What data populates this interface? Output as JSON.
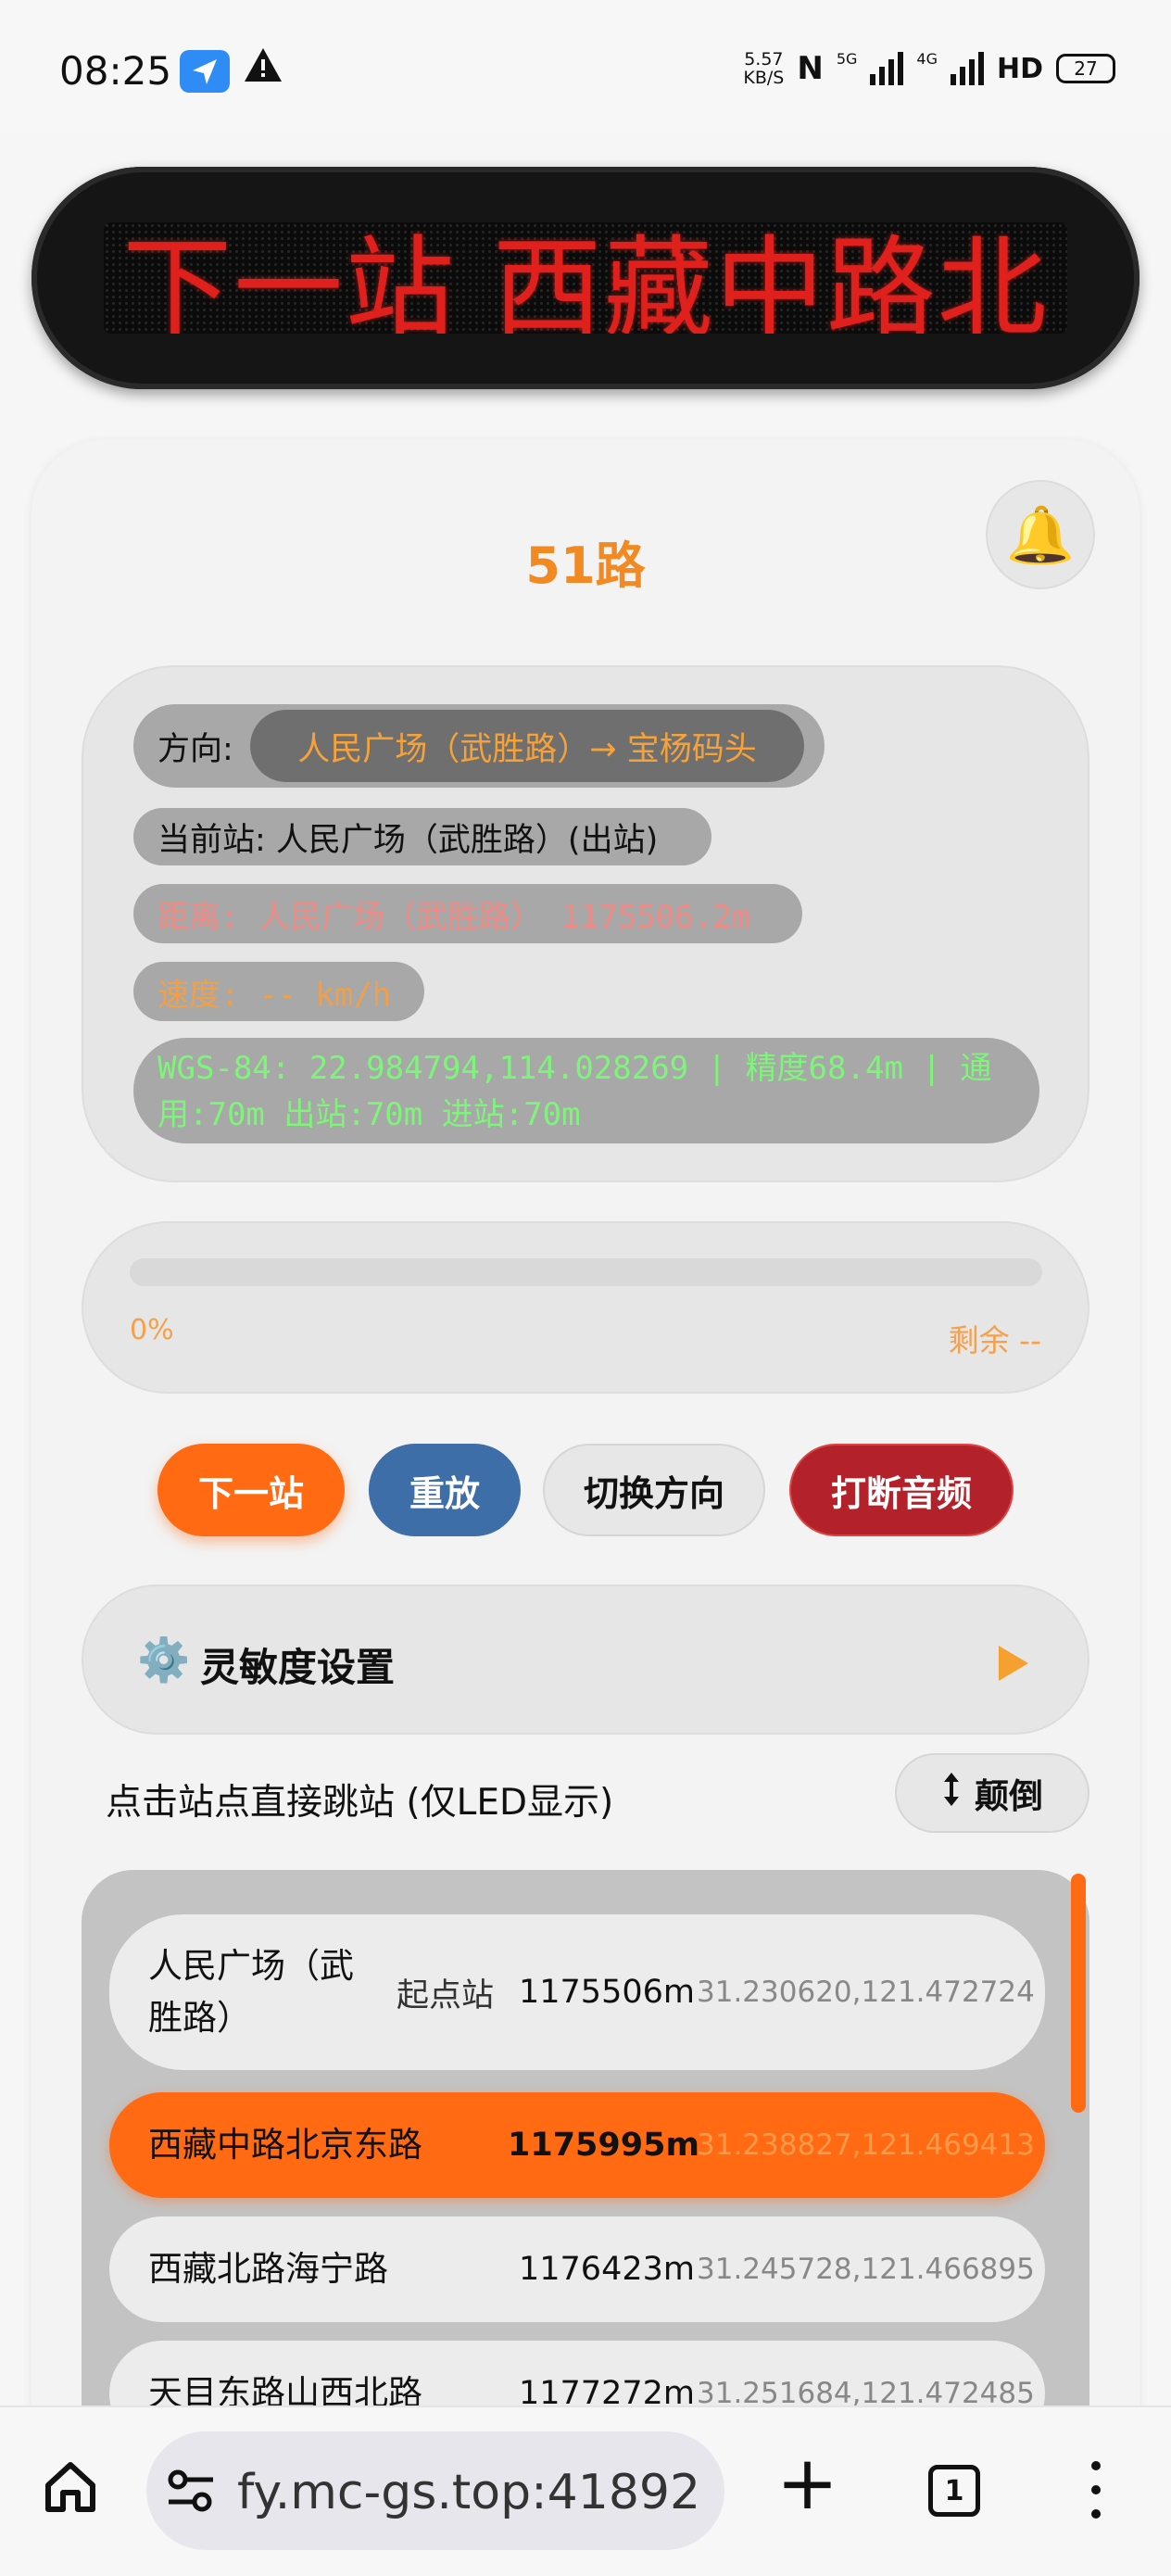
{
  "status_bar": {
    "time": "08:25",
    "net_speed_top": "5.57",
    "net_speed_unit": "KB/S",
    "signal_5g": "5G",
    "signal_4g": "4G",
    "hd": "HD",
    "battery": "27",
    "icons": [
      "navigation-icon",
      "warning-icon",
      "nfc-icon",
      "signal-icon"
    ]
  },
  "led": {
    "text": "下一站  西藏中路北",
    "color": "#e0201c"
  },
  "route": {
    "title": "51路",
    "bell_icon": "🔔"
  },
  "info": {
    "direction_label": "方向:",
    "direction_value": "人民广场（武胜路）→ 宝杨码头",
    "current_station": "当前站: 人民广场（武胜路）(出站)",
    "distance": "距离: 人民广场（武胜路） 1175506.2m",
    "speed": "速度: -- km/h",
    "gps": "WGS-84: 22.984794,114.028269 | 精度68.4m | 通用:70m 出站:70m 进站:70m"
  },
  "progress": {
    "percent_label": "0%",
    "percent_value": 0,
    "remaining": "剩余 --"
  },
  "buttons": {
    "next": "下一站",
    "replay": "重放",
    "switch_direction": "切换方向",
    "stop_audio": "打断音频"
  },
  "sensitivity": {
    "icon": "⚙️",
    "label": "灵敏度设置"
  },
  "station_list": {
    "hint": "点击站点直接跳站 (仅LED显示)",
    "flip_label": "颠倒",
    "items": [
      {
        "name": "人民广场（武胜路）",
        "tag": "起点站",
        "distance": "1175506m",
        "coord": "31.230620,121.472724"
      },
      {
        "name": "西藏中路北京东路",
        "tag": "",
        "distance": "1175995m",
        "coord": "31.238827,121.469413"
      },
      {
        "name": "西藏北路海宁路",
        "tag": "",
        "distance": "1176423m",
        "coord": "31.245728,121.466895"
      },
      {
        "name": "天目东路山西北路",
        "tag": "",
        "distance": "1177272m",
        "coord": "31.251684,121.472485"
      }
    ]
  },
  "browser": {
    "url": "fy.mc-gs.top:41892",
    "tab_count": "1"
  },
  "colors": {
    "accent": "#ff6a12",
    "replay": "#3d6ea8",
    "stop": "#b3222a",
    "route_title": "#f28a24"
  }
}
